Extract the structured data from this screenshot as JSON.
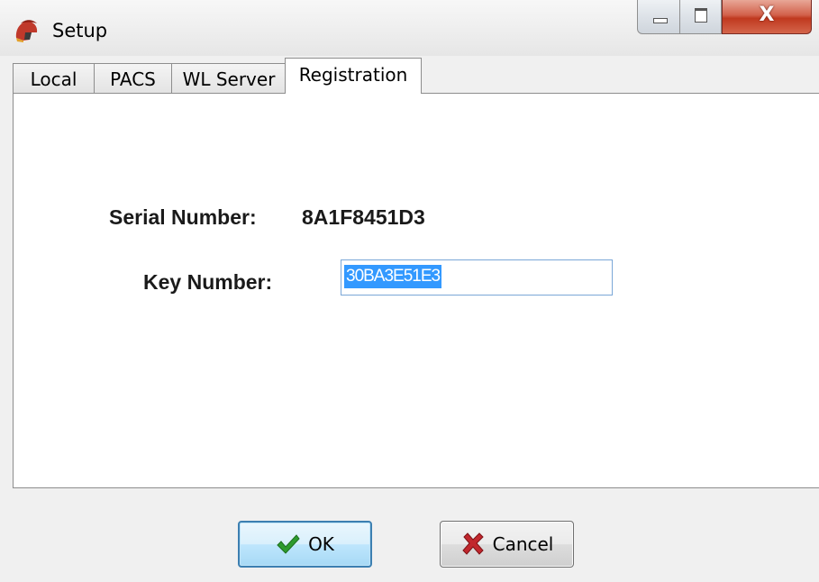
{
  "window": {
    "title": "Setup",
    "app_icon": "spartan-helmet-icon",
    "controls": {
      "minimize": "minimize-icon",
      "maximize": "maximize-icon",
      "close": "X"
    }
  },
  "tabs": [
    {
      "label": "Local",
      "active": false
    },
    {
      "label": "PACS",
      "active": false
    },
    {
      "label": "WL Server",
      "active": false
    },
    {
      "label": "Registration",
      "active": true
    }
  ],
  "registration": {
    "serial_label": "Serial Number:",
    "serial_value": "8A1F8451D3",
    "key_label": "Key Number:",
    "key_value": "30BA3E51E3"
  },
  "buttons": {
    "ok_label": "OK",
    "ok_icon": "checkmark-icon",
    "cancel_label": "Cancel",
    "cancel_icon": "red-x-icon"
  },
  "colors": {
    "selection": "#3399ff",
    "ok_check": "#2e9b2e",
    "cancel_x": "#c1272d",
    "close_button": "#c0391f"
  }
}
